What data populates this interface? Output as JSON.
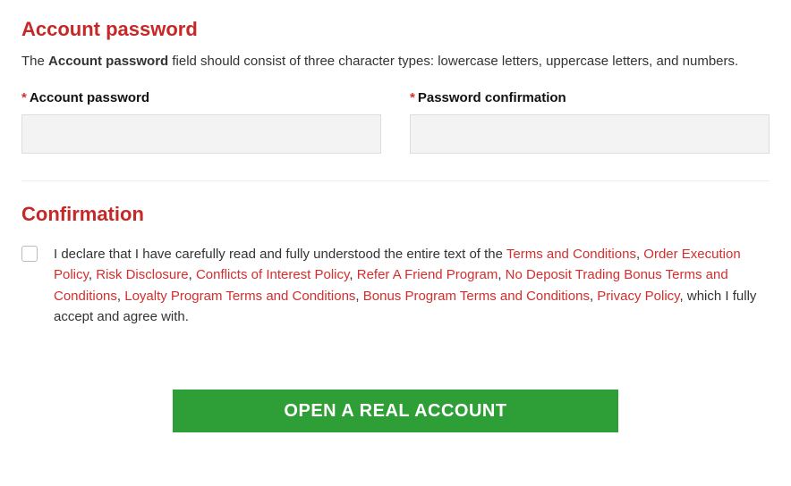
{
  "password": {
    "heading": "Account password",
    "description_prefix": "The ",
    "description_bold": "Account password",
    "description_suffix": " field should consist of three character types: lowercase letters, uppercase letters, and numbers.",
    "field1_label": "Account password",
    "field2_label": "Password confirmation",
    "asterisk": "*"
  },
  "confirmation": {
    "heading": "Confirmation",
    "decl_start": "I declare that I have carefully read and fully understood the entire text of the ",
    "links": {
      "terms": "Terms and Conditions",
      "order_exec": "Order Execution Policy",
      "risk": "Risk Disclosure",
      "conflicts": "Conflicts of Interest Policy",
      "refer": "Refer A Friend Program",
      "nodeposit": "No Deposit Trading Bonus Terms and Conditions",
      "loyalty": "Loyalty Program Terms and Conditions",
      "bonus": "Bonus Program Terms and Conditions",
      "privacy": "Privacy Policy"
    },
    "sep": ", ",
    "decl_end": ", which I fully accept and agree with."
  },
  "button": {
    "label": "Open a Real Account"
  }
}
